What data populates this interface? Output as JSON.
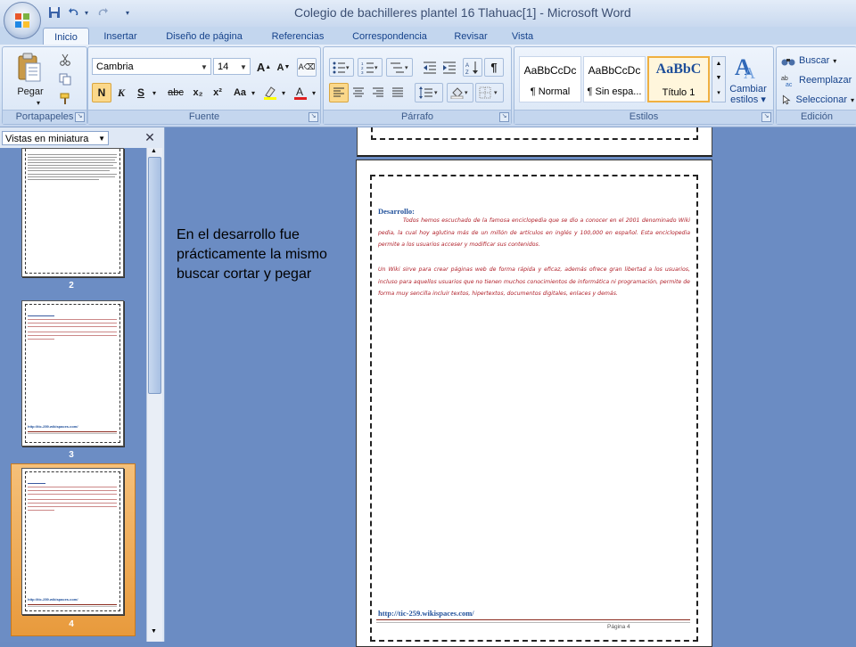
{
  "window": {
    "title": "Colegio de bachilleres plantel 16 Tlahuac[1] - Microsoft Word"
  },
  "quick_access": {
    "save_icon": "save-icon",
    "undo_icon": "undo-icon",
    "redo_icon": "redo-icon",
    "customize_icon": "chevron-down-icon"
  },
  "tabs": [
    "Inicio",
    "Insertar",
    "Diseño de página",
    "Referencias",
    "Correspondencia",
    "Revisar",
    "Vista"
  ],
  "ribbon": {
    "clipboard": {
      "label": "Portapapeles",
      "paste_label": "Pegar"
    },
    "font": {
      "label": "Fuente",
      "font_name": "Cambria",
      "font_size": "14",
      "bold": "N",
      "italic": "K",
      "underline": "S",
      "strike": "abc",
      "subscript": "x₂",
      "superscript": "x²",
      "case": "Aa"
    },
    "paragraph": {
      "label": "Párrafo"
    },
    "styles": {
      "label": "Estilos",
      "items": [
        {
          "preview": "AaBbCcDc",
          "name": "¶ Normal"
        },
        {
          "preview": "AaBbCcDc",
          "name": "¶ Sin espa..."
        },
        {
          "preview": "AaBbC",
          "name": "Título 1"
        }
      ],
      "change_styles_line1": "Cambiar",
      "change_styles_line2": "estilos"
    },
    "editing": {
      "label": "Edición",
      "find": "Buscar",
      "replace": "Reemplazar",
      "select": "Seleccionar"
    }
  },
  "thumbnail_pane": {
    "view_selector": "Vistas en miniatura",
    "pages": [
      "2",
      "3",
      "4"
    ],
    "page3_link": "http://tic-259.wikispaces.com/",
    "page4_link": "http://tic-259.wikispaces.com/"
  },
  "annotation": {
    "text": "En el desarrollo fue prácticamente la mismo buscar cortar y pegar"
  },
  "document": {
    "heading": "Desarrollo:",
    "paragraph1": "Todos hemos escuchado de la famosa enciclopedia que se dio a conocer en el 2001 denominado Wiki pedia, la cual hoy aglutina más de un millón de artículos en inglés y 100,000 en español. Esta enciclopedia permite a los usuarios acceser y modificar sus contenidos.",
    "paragraph2": "Un Wiki sirve para crear páginas web de forma rápida y eficaz, además ofrece gran libertad a los usuarios, incluso para aquellos usuarios que no tienen muchos conocimientos de informática ni programación, permite de forma muy sencilla incluir textos, hipertextos, documentos digitales, enlaces y demás.",
    "footer_link": "http://tic-259.wikispaces.com/",
    "page_number": "Página 4"
  }
}
